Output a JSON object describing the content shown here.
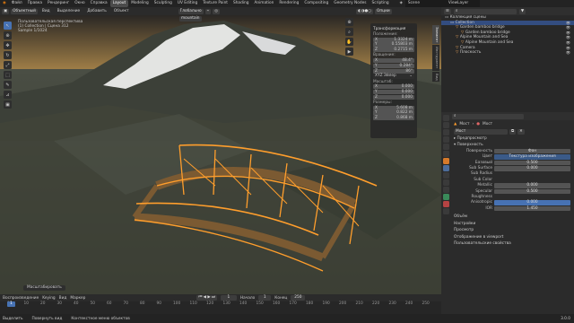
{
  "topbar": {
    "menus": [
      "Файл",
      "Правка",
      "Рендеринг",
      "Окно",
      "Справка"
    ],
    "workspaces": [
      "Layout",
      "Modeling",
      "Sculpting",
      "UV Editing",
      "Texture Paint",
      "Shading",
      "Animation",
      "Rendering",
      "Compositing",
      "Geometry Nodes",
      "Scripting"
    ],
    "scene": "Scene",
    "viewlayer": "ViewLayer"
  },
  "header": {
    "mode": "Объектный",
    "menus": [
      "Вид",
      "Выделение",
      "Добавить",
      "Объект"
    ],
    "transform": "Глобально",
    "options": "Опции"
  },
  "viewport": {
    "view_name": "Пользовательская перспектива",
    "collection": "(1) Collection | Сцена 312",
    "sample": "Sample 1/1024",
    "breadcrumb": "mountain"
  },
  "npanel": {
    "title": "Трансформация",
    "location_label": "Положение:",
    "location": [
      [
        "X",
        "1.3324 m"
      ],
      [
        "Y",
        "0.55803 m"
      ],
      [
        "Z",
        "0.2715 m"
      ]
    ],
    "rotation_label": "Вращение:",
    "rotation": [
      [
        "X",
        "48.4°"
      ],
      [
        "Y",
        "0.284°"
      ],
      [
        "Z",
        "86°"
      ]
    ],
    "mode": "XYZ Эйлер",
    "scale_label": "Масштаб:",
    "scale": [
      [
        "X",
        "0.000"
      ],
      [
        "Y",
        "0.000"
      ],
      [
        "Z",
        "0.000"
      ]
    ],
    "dims_label": "Размеры:",
    "dims": [
      [
        "X",
        "5.608 m"
      ],
      [
        "Y",
        "0.822 m"
      ],
      [
        "Z",
        "0.868 m"
      ]
    ],
    "tabs": [
      "Элемент",
      "Инструмент",
      "Вид"
    ]
  },
  "tooltip": "Масштабировать",
  "timeline": {
    "menus": [
      "Воспроизведение",
      "Keying",
      "Вид",
      "Маркер"
    ],
    "current": "1",
    "start_label": "Начало",
    "start": "1",
    "end_label": "Конец",
    "end": "250",
    "ticks": [
      "0",
      "10",
      "20",
      "30",
      "40",
      "50",
      "60",
      "70",
      "80",
      "90",
      "100",
      "110",
      "120",
      "130",
      "140",
      "150",
      "160",
      "170",
      "180",
      "190",
      "200",
      "210",
      "220",
      "230",
      "240",
      "250"
    ]
  },
  "status": {
    "items": [
      "Выделить",
      "Повернуть вид",
      "Контекстное меню объектов"
    ],
    "version": "3.0.0"
  },
  "outliner": {
    "title": "Коллекция сцены",
    "items": [
      {
        "label": "Collection",
        "depth": 1
      },
      {
        "label": "Garden bamboo bridge",
        "depth": 2
      },
      {
        "label": "Garden bamboo bridge",
        "depth": 3
      },
      {
        "label": "Alpine Mountain and Sea",
        "depth": 2
      },
      {
        "label": "Alpine Mountain and Sea",
        "depth": 3
      },
      {
        "label": "Camera",
        "depth": 2
      },
      {
        "label": "Плоскость",
        "depth": 2
      }
    ]
  },
  "props": {
    "object": "Мост",
    "material": "Мост",
    "surface_label": "Поверхность",
    "surface": "Фон",
    "sections": [
      "Предпросмотр",
      "Поверхность"
    ],
    "shader_label": "Цвет",
    "shader": "Текстура изображения",
    "rows": [
      [
        "Базовый",
        "0.500"
      ],
      [
        "Sub Surface",
        "0.000"
      ],
      [
        "Sub Radius",
        ""
      ],
      [
        "Sub Color",
        ""
      ],
      [
        "Metallic",
        "0.000"
      ],
      [
        "Specular",
        "0.500"
      ],
      [
        "Roughness",
        ""
      ],
      [
        "Anisotropic",
        "0.000"
      ],
      [
        "IOR",
        "1.450"
      ]
    ],
    "footer": [
      "Объём",
      "Настройки",
      "Просмотр",
      "Отображение в viewport",
      "Пользовательские свойства"
    ]
  },
  "colors": {
    "accent": "#4772b3",
    "select": "#ff9e2c"
  }
}
